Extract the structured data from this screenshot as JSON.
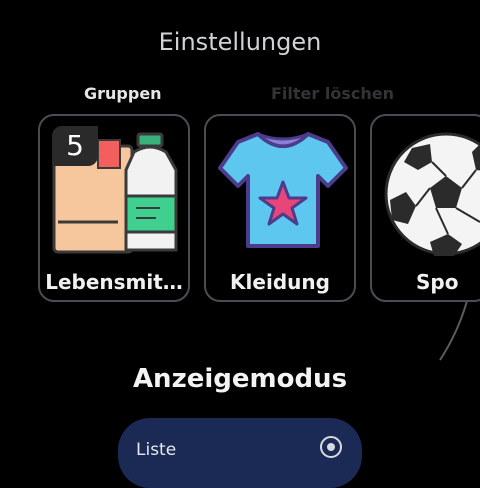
{
  "header": {
    "title": "Einstellungen"
  },
  "tabs": [
    {
      "label": "Gruppen"
    },
    {
      "label": "Filter löschen"
    }
  ],
  "groups": [
    {
      "label": "Lebensmit…",
      "badge": "5",
      "icon": "grocery-icon"
    },
    {
      "label": "Kleidung",
      "icon": "tshirt-icon"
    },
    {
      "label": "Spo",
      "icon": "soccer-ball-icon"
    }
  ],
  "display_mode": {
    "title": "Anzeigemodus",
    "option_label": "Liste"
  },
  "colors": {
    "background": "#000000",
    "card_border": "#4a4d53",
    "option_bg": "#1b2a55",
    "tshirt": "#5ec7f0",
    "star": "#e8467a"
  }
}
